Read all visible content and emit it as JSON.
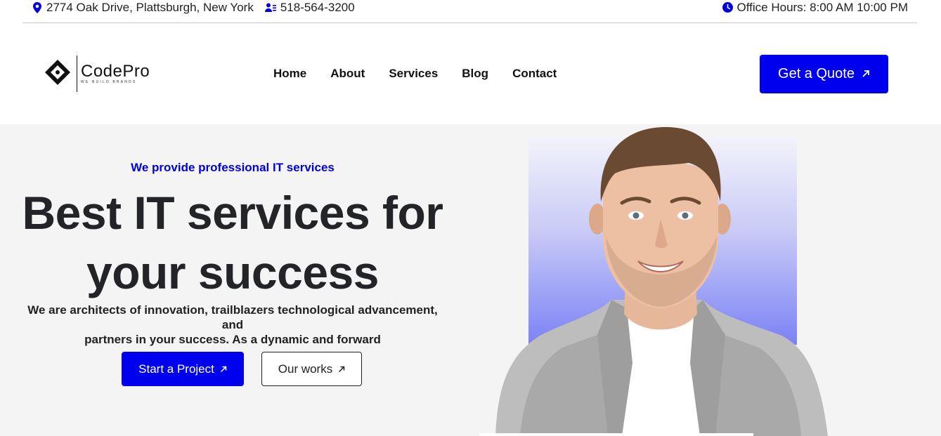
{
  "topbar": {
    "address": "2774 Oak Drive, Plattsburgh, New York",
    "phone": "518-564-3200",
    "hours": "Office Hours: 8:00 AM 10:00 PM",
    "icons": {
      "address": "location-pin-icon",
      "phone": "phone-user-icon",
      "hours": "clock-icon"
    }
  },
  "header": {
    "logo": {
      "brand": "CodePro",
      "tagline": "WE BUILD BRANDS"
    },
    "nav": [
      "Home",
      "About",
      "Services",
      "Blog",
      "Contact"
    ],
    "quote_button": "Get a Quote"
  },
  "hero": {
    "eyebrow": "We provide professional IT services",
    "headline_line1": "Best IT services for",
    "headline_line2": "your success",
    "description_line1": "We are architects of innovation, trailblazers technological advancement, and",
    "description_line2": "partners in your success. As a dynamic and forward",
    "primary_button": "Start a Project",
    "secondary_button": "Our works"
  },
  "colors": {
    "accent": "#0000EE",
    "text_dark": "#222428",
    "hero_bg": "#F4F4F4",
    "photo_gradient_top": "#F3F3FB",
    "photo_gradient_bottom": "#7B82F5"
  }
}
